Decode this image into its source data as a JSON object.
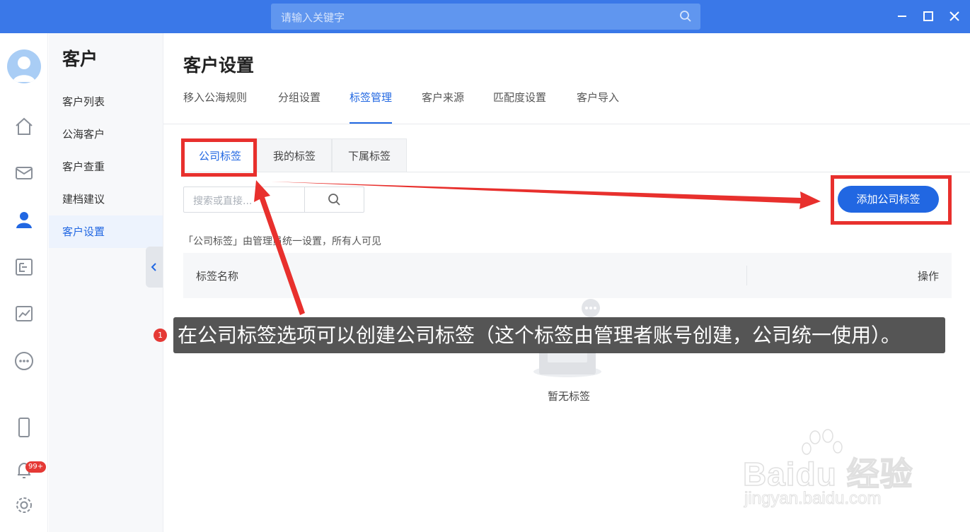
{
  "titlebar": {
    "search_placeholder": "请输入关键字",
    "controls": [
      "minimize-icon",
      "maximize-icon",
      "close-icon"
    ]
  },
  "rail": {
    "icons": [
      "home-icon",
      "mail-icon",
      "customer-icon",
      "folder-tree-icon",
      "chart-icon",
      "more-icon",
      "phone-icon",
      "bell-icon",
      "settings-icon"
    ],
    "notification_badge": "99+"
  },
  "sidebar": {
    "title": "客户",
    "items": [
      {
        "label": "客户列表"
      },
      {
        "label": "公海客户"
      },
      {
        "label": "客户查重"
      },
      {
        "label": "建档建议"
      },
      {
        "label": "客户设置",
        "active": true
      }
    ]
  },
  "main": {
    "title": "客户设置",
    "tabs": [
      {
        "label": "移入公海规则"
      },
      {
        "label": "分组设置"
      },
      {
        "label": "标签管理",
        "active": true
      },
      {
        "label": "客户来源"
      },
      {
        "label": "匹配度设置"
      },
      {
        "label": "客户导入"
      }
    ],
    "subtabs": [
      {
        "label": "公司标签",
        "active": true
      },
      {
        "label": "我的标签"
      },
      {
        "label": "下属标签"
      }
    ],
    "search_placeholder": "搜索或直接...",
    "add_button": "添加公司标签",
    "hint": "「公司标签」由管理员统一设置，所有人可见",
    "table": {
      "columns": [
        "标签名称",
        "操作"
      ],
      "empty_text": "暂无标签"
    }
  },
  "annotation": {
    "step": "1",
    "caption": "在公司标签选项可以创建公司标签（这个标签由管理者账号创建，公司统一使用）。",
    "highlight_color": "#e8302d"
  },
  "watermark": {
    "brand": "Bai",
    "brand2": "du",
    "brand3": "经验",
    "url": "jingyan.baidu.com"
  },
  "colors": {
    "titlebar": "#3a78e8",
    "accent": "#2167e2"
  }
}
